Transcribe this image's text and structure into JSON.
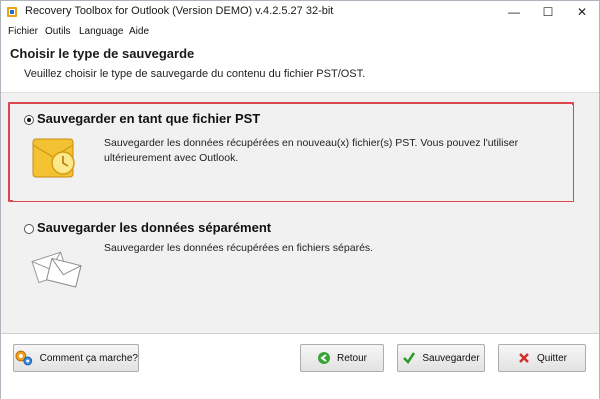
{
  "window": {
    "title": "Recovery Toolbox for Outlook (Version DEMO) v.4.2.5.27 32-bit",
    "controls": {
      "minimize": "—",
      "maximize": "☐",
      "close": "✕"
    }
  },
  "menu": [
    "Fichier",
    "Outils",
    "Language",
    "Aide"
  ],
  "header": {
    "title": "Choisir le type de sauvegarde",
    "subtitle": "Veuillez choisir le type de sauvegarde du contenu du fichier PST/OST."
  },
  "options": [
    {
      "title": "Sauvegarder en tant que fichier PST",
      "description": "Sauvegarder les données récupérées en nouveau(x) fichier(s) PST.  Vous pouvez l'utiliser ultérieurement avec Outlook.",
      "selected": true,
      "icon": "outlook-pst-icon"
    },
    {
      "title": "Sauvegarder les données séparément",
      "description": "Sauvegarder les données récupérées en fichiers séparés.",
      "selected": false,
      "icon": "envelopes-icon"
    }
  ],
  "footer": {
    "help_label": "Comment ça marche?",
    "back_label": "Retour",
    "save_label": "Sauvegarder",
    "quit_label": "Quitter"
  },
  "colors": {
    "highlight": "#d9464b",
    "content_bg": "#f1f1f1"
  }
}
